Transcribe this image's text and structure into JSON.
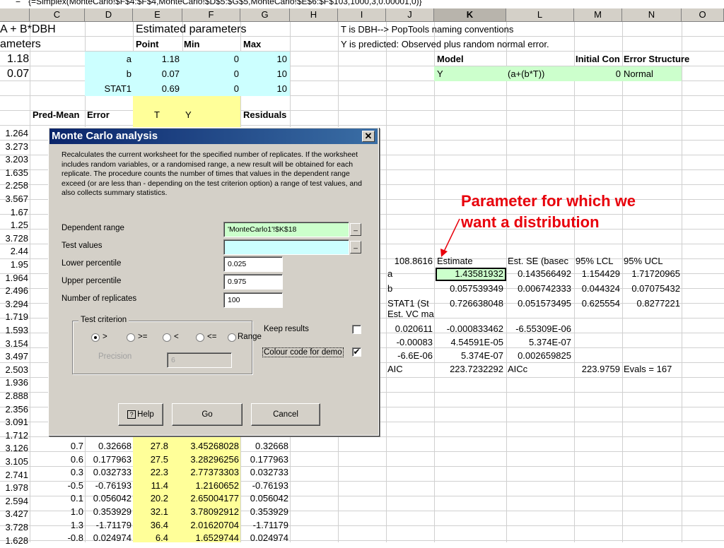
{
  "formula_bar": {
    "fx": "=",
    "formula": "{=Simplex(MonteCarlo!$F$4:$F$4,MonteCarlo!$D$5:$G$5,MonteCarlo!$E$6:$F$103,1000,3,0.00001,0)}"
  },
  "columns": [
    "C",
    "D",
    "E",
    "F",
    "G",
    "H",
    "I",
    "J",
    "K",
    "L",
    "M",
    "N",
    "O"
  ],
  "annotation": {
    "line1": "Parameter for which we",
    "line2": "want a distribution"
  },
  "cells": {
    "title_model": "A + B*DBH",
    "title_params": "ameters",
    "big_a": "1.18",
    "big_b": "0.07",
    "estimated_parameters": "Estimated parameters",
    "hdr_point": "Point",
    "hdr_min": "Min",
    "hdr_max": "Max",
    "row_a": {
      "label": "a",
      "point": "1.18",
      "min": "0",
      "max": "10"
    },
    "row_b": {
      "label": "b",
      "point": "0.07",
      "min": "0",
      "max": "10"
    },
    "row_stat": {
      "label": "STAT1",
      "point": "0.69",
      "min": "0",
      "max": "10"
    },
    "note1": "T is DBH--> PopTools naming conventions",
    "note2": "Y is predicted: Observed plus random normal error.",
    "hdr_model": "Model",
    "hdr_initial": "Initial Con",
    "hdr_error": "Error Structure",
    "model_y": "Y",
    "model_eq": "(a+(b*T))",
    "model_init": "0",
    "model_err": "Normal",
    "hdr_predmean": "Pred-Mean",
    "hdr_err": "Error",
    "hdr_t": "T",
    "hdr_y": "Y",
    "hdr_resid": "Residuals"
  },
  "col_b_values": [
    "1.264",
    "3.273",
    "3.203",
    "1.635",
    "2.258",
    "3.567",
    "1.67",
    "1.25",
    "3.728",
    "2.44",
    "1.95",
    "1.964",
    "2.496",
    "3.294",
    "1.719",
    "1.593",
    "3.154",
    "3.497",
    "2.503",
    "1.936",
    "2.888",
    "2.356",
    "3.091",
    "1.712",
    "3.126",
    "3.105",
    "2.741",
    "1.978",
    "2.594",
    "3.427",
    "3.728",
    "1.628"
  ],
  "bottom_rows": [
    {
      "c": "0.7",
      "d": "0.32668",
      "e": "27.8",
      "f": "3.45268028",
      "g": "0.32668"
    },
    {
      "c": "0.6",
      "d": "0.177963",
      "e": "27.5",
      "f": "3.28296256",
      "g": "0.177963"
    },
    {
      "c": "0.3",
      "d": "0.032733",
      "e": "22.3",
      "f": "2.77373303",
      "g": "0.032733"
    },
    {
      "c": "-0.5",
      "d": "-0.76193",
      "e": "11.4",
      "f": "1.2160652",
      "g": "-0.76193"
    },
    {
      "c": "0.1",
      "d": "0.056042",
      "e": "20.2",
      "f": "2.65004177",
      "g": "0.056042"
    },
    {
      "c": "1.0",
      "d": "0.353929",
      "e": "32.1",
      "f": "3.78092912",
      "g": "0.353929"
    },
    {
      "c": "1.3",
      "d": "-1.71179",
      "e": "36.4",
      "f": "2.01620704",
      "g": "-1.71179"
    },
    {
      "c": "-0.8",
      "d": "0.024974",
      "e": "6.4",
      "f": "1.6529744",
      "g": "0.024974"
    }
  ],
  "results": {
    "n": "108.8616",
    "hdr_estimate": "Estimate",
    "hdr_se": "Est. SE (basec",
    "hdr_lcl": "95% LCL",
    "hdr_ucl": "95% UCL",
    "rows": [
      {
        "label": "a",
        "est": "1.43581932",
        "se": "0.143566492",
        "lcl": "1.154429",
        "ucl": "1.71720965"
      },
      {
        "label": "b",
        "est": "0.057539349",
        "se": "0.006742333",
        "lcl": "0.044324",
        "ucl": "0.07075432"
      },
      {
        "label": "STAT1 (St",
        "est": "0.726638048",
        "se": "0.051573495",
        "lcl": "0.625554",
        "ucl": "0.8277221"
      }
    ],
    "vc_label": "Est. VC ma",
    "vc_rows": [
      [
        "0.020611",
        "-0.000833462",
        "-6.55309E-06"
      ],
      [
        "-0.00083",
        "4.54591E-05",
        "5.374E-07"
      ],
      [
        "-6.6E-06",
        "5.374E-07",
        "0.002659825"
      ]
    ],
    "aic_label": "AIC",
    "aic": "223.7232292",
    "aicc_label": "AICc",
    "aicc": "223.9759",
    "evals": "Evals = 167"
  },
  "dialog": {
    "title": "Monte Carlo analysis",
    "description": "Recalculates the current worksheet for the specified number of replicates. If the worksheet includes random variables, or a randomised range, a new result will be obtained for each replicate. The procedure counts the number of times that values in the dependent range exceed (or are less than - depending on the test criterion option) a range of test values, and also collects summary statistics.",
    "dependent_range_label": "Dependent range",
    "dependent_range_value": "'MonteCarlo1'!$K$18",
    "test_values_label": "Test values",
    "test_values_value": "",
    "lower_percentile_label": "Lower percentile",
    "lower_percentile_value": "0.025",
    "upper_percentile_label": "Upper percentile",
    "upper_percentile_value": "0.975",
    "replicates_label": "Number of replicates",
    "replicates_value": "100",
    "test_criterion_label": "Test criterion",
    "criteria": [
      ">",
      ">=",
      "<",
      "<=",
      "Range"
    ],
    "selected_criterion": ">",
    "precision_label": "Precision",
    "precision_value": "6",
    "keep_results_label": "Keep results",
    "colour_code_label": "Colour code for demo",
    "colour_code_checked": "✔",
    "help_label": "Help",
    "go_label": "Go",
    "cancel_label": "Cancel"
  },
  "colors": {
    "cyan_fill": "#ccffff",
    "yellow_fill": "#ffff99",
    "green_fill": "#ccffcc",
    "annotation_red": "#e8000b",
    "title_bar": "#0a246a"
  }
}
